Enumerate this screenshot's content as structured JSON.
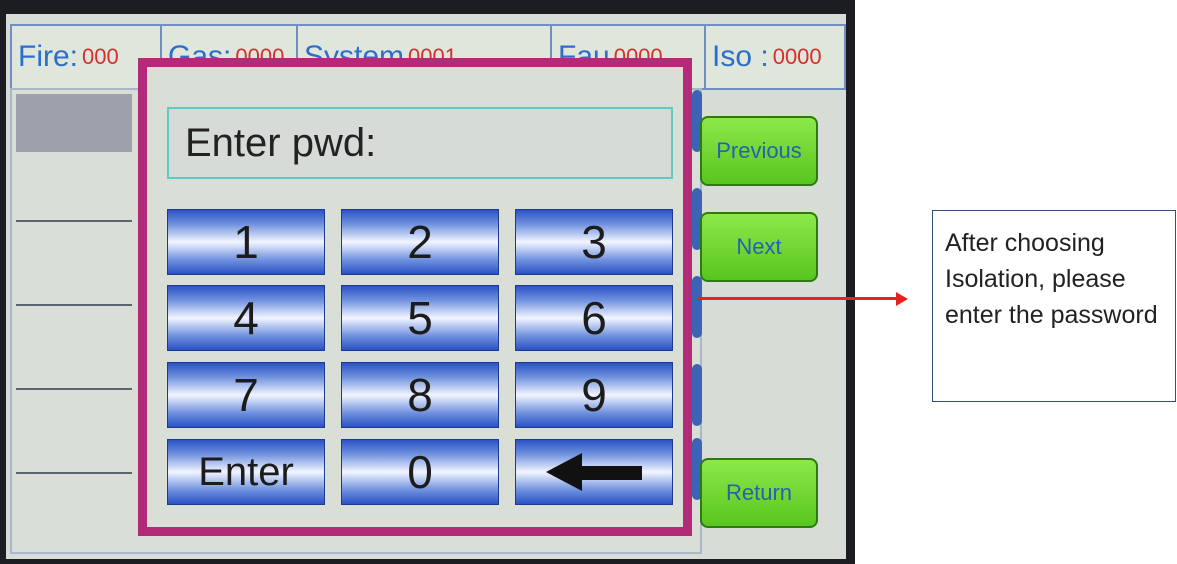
{
  "status_bar": {
    "fire_label": "Fire:",
    "fire_value": "000",
    "gas_label": "Gas:",
    "gas_value": "0000",
    "system_label": "System",
    "system_value": "0001",
    "fault_label": "Fau",
    "fault_value": "0000",
    "iso_label": "Iso :",
    "iso_value": "0000"
  },
  "side_buttons": {
    "previous": "Previous",
    "next": "Next",
    "return": "Return"
  },
  "dialog": {
    "prompt": "Enter pwd:",
    "keys": {
      "k1": "1",
      "k2": "2",
      "k3": "3",
      "k4": "4",
      "k5": "5",
      "k6": "6",
      "k7": "7",
      "k8": "8",
      "k9": "9",
      "enter": "Enter",
      "k0": "0"
    },
    "backspace_icon": "left-arrow-icon"
  },
  "callout": {
    "text": "After choosing Isolation, please enter the password"
  },
  "colors": {
    "dialog_border": "#b22a78",
    "side_button": "#6fd833",
    "pointer": "#e8231d",
    "status_text": "#2c6ec9",
    "status_value": "#d62f2f"
  }
}
